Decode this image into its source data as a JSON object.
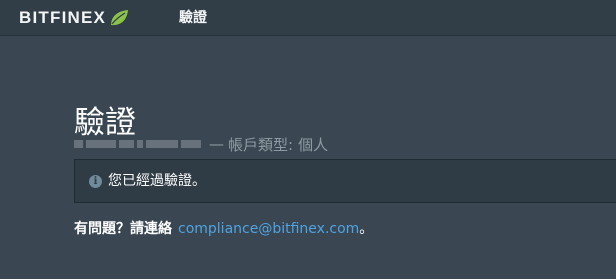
{
  "header": {
    "logo_text": "BITFINEX",
    "nav_title": "驗證"
  },
  "main": {
    "title": "驗證",
    "account_separator": "—",
    "account_type_label": "帳戶類型:",
    "account_type_value": "個人",
    "notice_text": "您已經過驗證。",
    "contact_label": "有問題？請連絡",
    "contact_email": "compliance@bitfinex.com",
    "contact_suffix": "。"
  },
  "colors": {
    "background": "#3a4752",
    "topbar": "#313d47",
    "link": "#4fa3e0",
    "leaf_green": "#8bc34a"
  },
  "icons": {
    "logo_leaf": "leaf-icon",
    "notice": "info-icon"
  }
}
